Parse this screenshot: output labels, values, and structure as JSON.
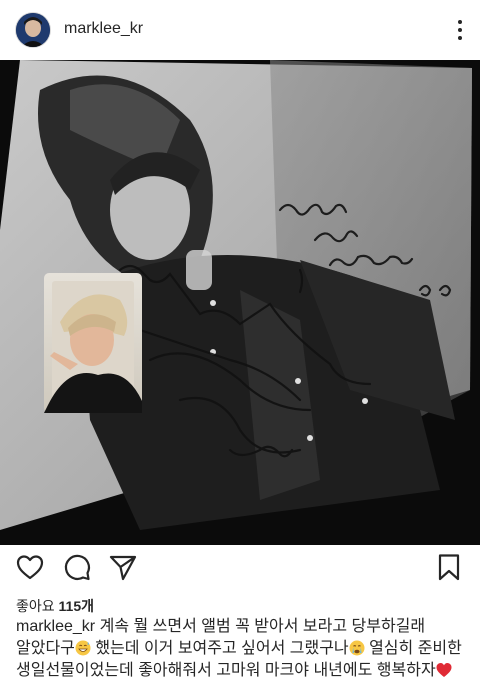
{
  "header": {
    "username": "marklee_kr",
    "avatar_icon": "profile-photo",
    "menu_icon": "more-vertical-icon"
  },
  "post": {
    "photo": {
      "description_icon": "signed-album-photo",
      "handwriting": [
        "마크야꼭",
        "너무",
        "고마웠어요",
        "DO",
        "Mark"
      ]
    },
    "actions": [
      "heart-icon",
      "comment-icon",
      "share-icon",
      "bookmark-icon"
    ],
    "likes_label": "좋아요",
    "likes_count": "115개",
    "caption": {
      "username": "marklee_kr",
      "text1": "계속 뭘 쓰면서 앨범 꼭 받아서 보라고 당부하길래",
      "text2": "알았다구",
      "text3": " 했는데 이거 보여주고 싶어서 그랬구나",
      "text4": " 열심히 준비한",
      "text5": "생일선물이었는데 좋아해줘서 고마워 마크야 내년에도 행복하자"
    }
  },
  "colors": {
    "text": "#262626",
    "heart": "#e0245e"
  }
}
